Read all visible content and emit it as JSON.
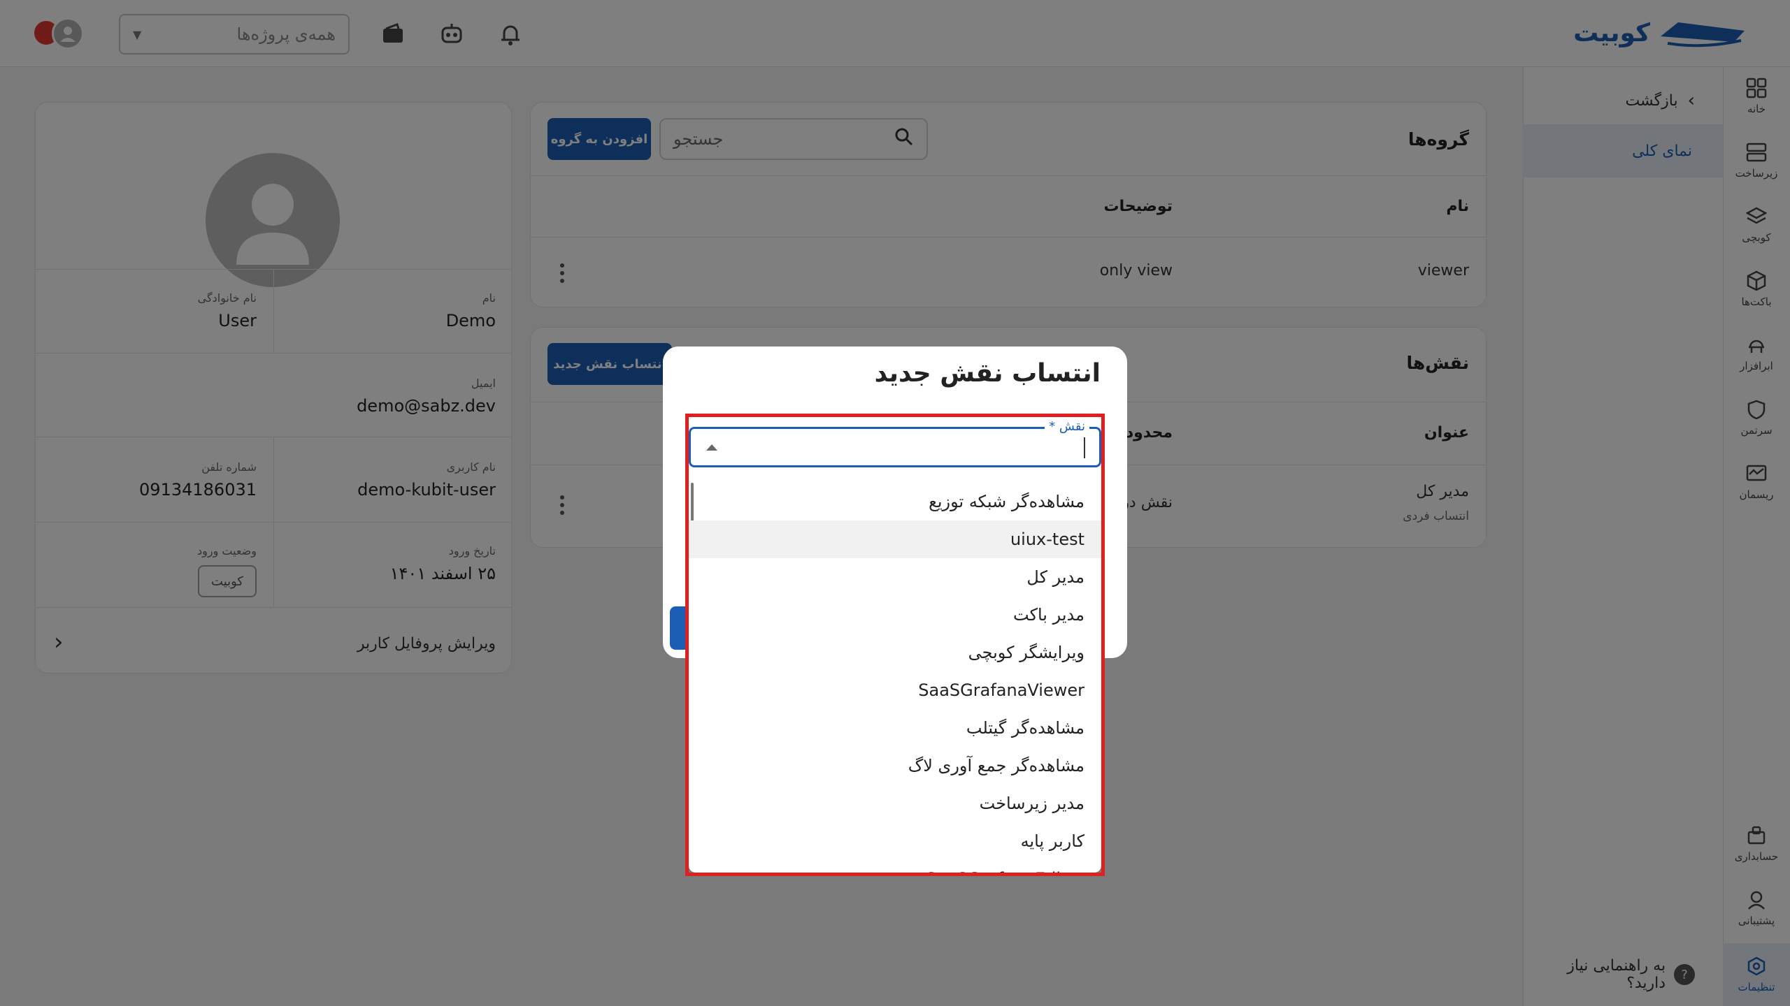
{
  "header": {
    "logo_text": "کوبیت",
    "project_select_placeholder": "همه‌ی پروژه‌ها",
    "icons": [
      "wallet-icon",
      "robot-icon",
      "bell-icon"
    ]
  },
  "rail": {
    "items": [
      {
        "label": "خانه",
        "icon": "grid-icon"
      },
      {
        "label": "زیرساخت",
        "icon": "server-icon"
      },
      {
        "label": "کوبچی",
        "icon": "layers-icon"
      },
      {
        "label": "باکت‌ها",
        "icon": "box-icon"
      },
      {
        "label": "ابرافزار",
        "icon": "cloud-app-icon"
      },
      {
        "label": "سرتمن",
        "icon": "shield-icon"
      },
      {
        "label": "ریسمان",
        "icon": "monitor-icon"
      },
      {
        "label": "حسابداری",
        "icon": "accounting-icon"
      },
      {
        "label": "پشتیبانی",
        "icon": "support-icon"
      },
      {
        "label": "تنظیمات",
        "icon": "settings-icon"
      }
    ]
  },
  "subnav": {
    "back": "بازگشت",
    "active": "نمای کلی",
    "help": "به راهنمایی نیاز دارید؟"
  },
  "groups": {
    "title": "گروه‌ها",
    "search_placeholder": "جستجو",
    "add_button": "افزودن به گروه",
    "columns": {
      "name": "نام",
      "description": "توضیحات"
    },
    "rows": [
      {
        "name": "viewer",
        "description": "only view"
      }
    ]
  },
  "roles": {
    "title": "نقش‌ها",
    "assign_button": "انتساب نقش جدید",
    "columns": {
      "title": "عنوان",
      "scope": "محدوده"
    },
    "rows": [
      {
        "title": "مدیر کل",
        "subtitle": "انتساب فردی",
        "scope": "نقش در"
      }
    ]
  },
  "profile": {
    "first_name_label": "نام",
    "first_name": "Demo",
    "last_name_label": "نام خانوادگی",
    "last_name": "User",
    "email_label": "ایمیل",
    "email": "demo@sabz.dev",
    "username_label": "نام کاربری",
    "username": "demo-kubit-user",
    "phone_label": "شماره تلفن",
    "phone": "09134186031",
    "login_date_label": "تاریخ ورود",
    "login_date": "۲۵ اسفند ۱۴۰۱",
    "login_status_label": "وضعیت ورود",
    "login_status": "کوبیت",
    "edit_profile": "ویرایش پروفایل کاربر"
  },
  "dialog": {
    "title": "انتساب نقش جدید",
    "field_label": "نقش *",
    "options": [
      "مشاهده‌گر شبکه توزیع",
      "uiux-test",
      "مدیر کل",
      "مدیر باکت",
      "ویرایشگر کوبچی",
      "SaaSGrafanaViewer",
      "مشاهده‌گر گیتلب",
      "مشاهده‌گر جمع آوری لاگ",
      "مدیر زیرساخت",
      "کاربر پایه",
      "SaaSGrafanaEditor"
    ]
  },
  "colors": {
    "primary": "#1a5fb4",
    "highlight": "#e02020",
    "overlay": "rgba(0,0,0,0.5)"
  }
}
